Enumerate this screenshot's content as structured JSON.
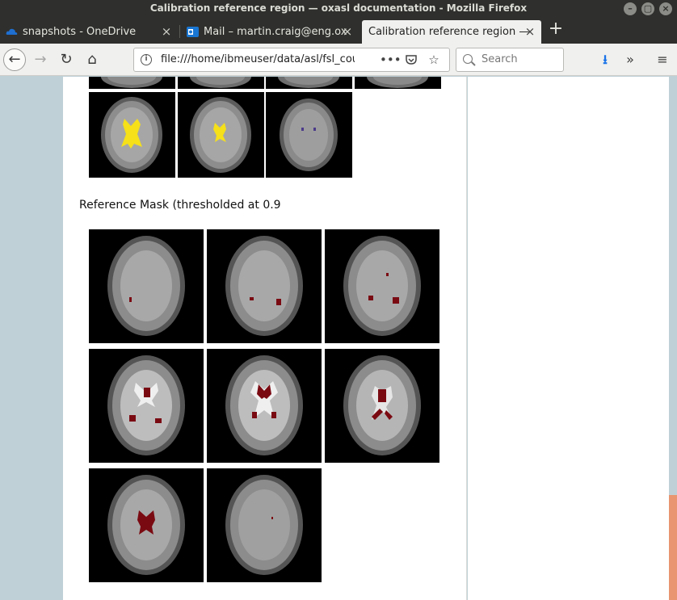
{
  "window": {
    "title": "Calibration reference region — oxasl documentation - Mozilla Firefox"
  },
  "tabs": [
    {
      "label": "snapshots - OneDrive",
      "icon": "onedrive-cloud-icon"
    },
    {
      "label": "Mail – martin.craig@eng.ox",
      "icon": "outlook-mail-icon"
    },
    {
      "label": "Calibration reference region —",
      "icon": "",
      "active": true
    }
  ],
  "navbar": {
    "url": "file:///home/ibmeuser/data/asl/fsl_cours",
    "search_placeholder": "Search"
  },
  "page": {
    "reference_mask_label": "Reference Mask (thresholded at 0.9"
  },
  "colors": {
    "csf_mask_yellow": "#f5e01a",
    "reference_mask_red": "#7a0a12",
    "page_background": "#bfd1d7",
    "scroll_thumb": "#e89570"
  }
}
